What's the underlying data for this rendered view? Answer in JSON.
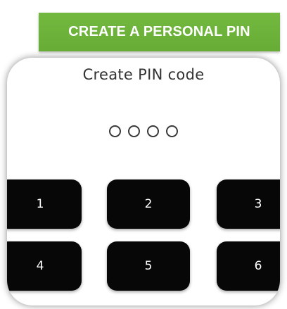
{
  "banner": {
    "text": "CREATE A PERSONAL PIN",
    "color": "#6bb13a"
  },
  "screen": {
    "title": "Create PIN code",
    "pin_slots_filled": 0,
    "pin_slots_total": 4
  },
  "keypad": {
    "keys": [
      "1",
      "2",
      "3",
      "4",
      "5",
      "6"
    ]
  }
}
